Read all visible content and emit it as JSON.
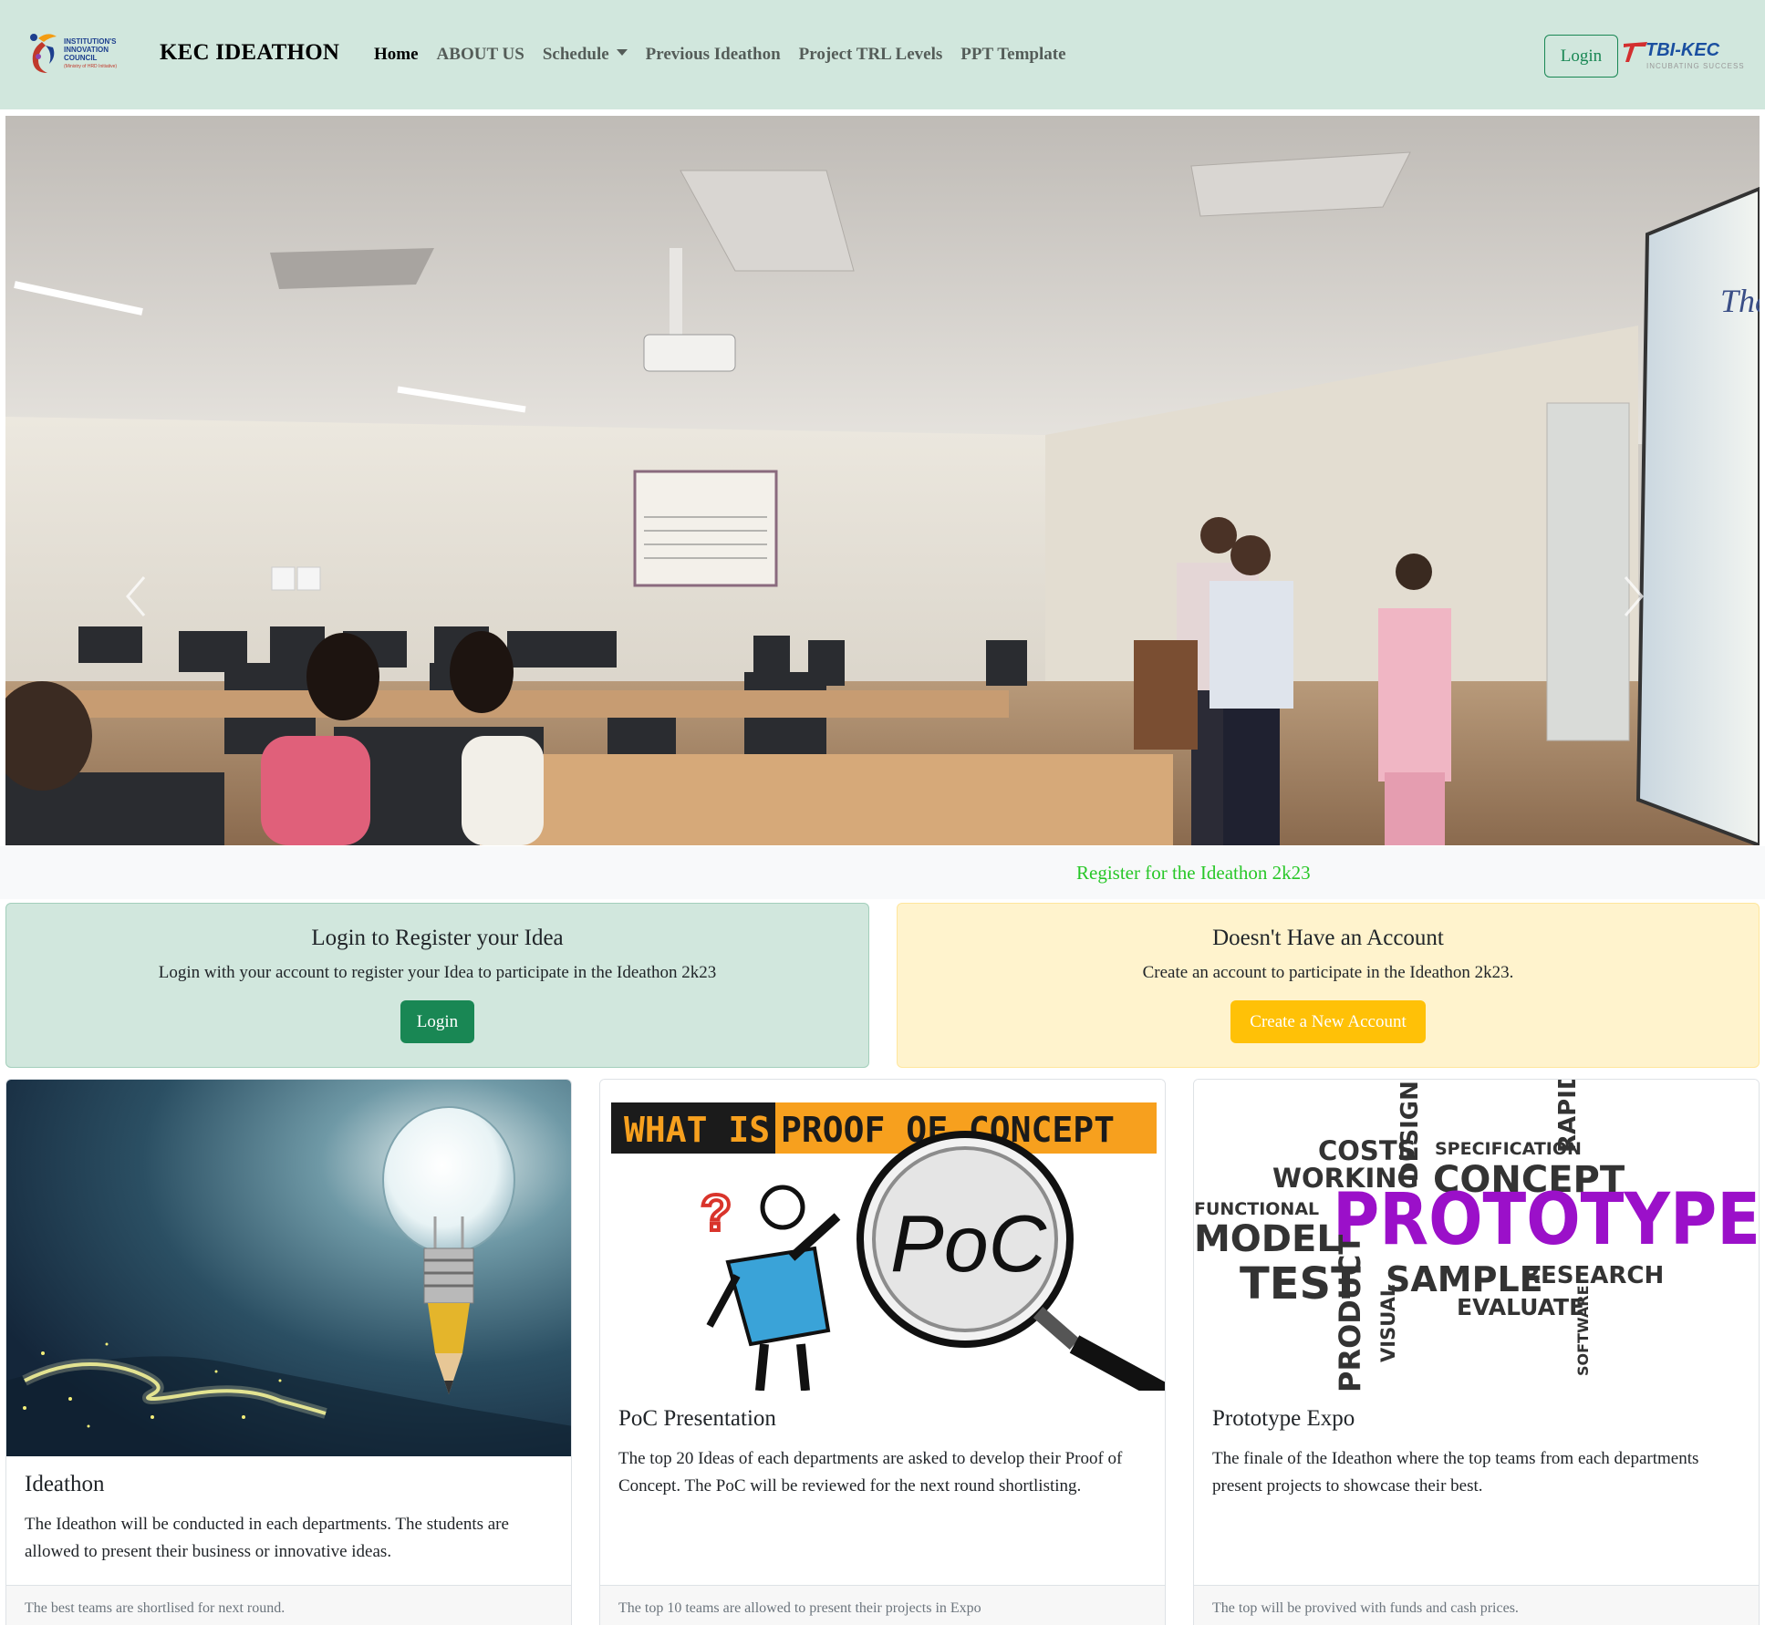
{
  "navbar": {
    "iic_logo_text": "INSTITUTION'S INNOVATION COUNCIL",
    "iic_logo_subtext": "(Ministry of HRD Initiative)",
    "brand": "KEC IDEATHON",
    "links": [
      {
        "label": "Home",
        "active": true
      },
      {
        "label": "ABOUT US"
      },
      {
        "label": "Schedule",
        "dropdown": true
      },
      {
        "label": "Previous Ideathon"
      },
      {
        "label": "Project TRL Levels"
      },
      {
        "label": "PPT Template"
      }
    ],
    "login_label": "Login",
    "tbi_logo_text": "TBI-KEC",
    "tbi_logo_subtext": "INCUBATING SUCCESS"
  },
  "carousel": {
    "prev_icon": "chevron-left-icon",
    "next_icon": "chevron-right-icon",
    "screen_text": "The P"
  },
  "marquee": {
    "text": "Register for the Ideathon 2k23",
    "color": "#28c728"
  },
  "login_callout": {
    "title": "Login to Register your Idea",
    "text": "Login with your account to register your Idea to participate in the Ideathon 2k23",
    "button": "Login"
  },
  "account_callout": {
    "title": "Doesn't Have an Account",
    "text": "Create an account to participate in the Ideathon 2k23.",
    "button": "Create a New Account"
  },
  "cards": [
    {
      "title": "Ideathon",
      "text": "The Ideathon will be conducted in each departments. The students are allowed to present their business or innovative ideas.",
      "footer": "The best teams are shortlised for next round."
    },
    {
      "title": "PoC Presentation",
      "text": "The top 20 Ideas of each departments are asked to develop their Proof of Concept. The PoC will be reviewed for the next round shortlisting.",
      "footer": "The top 10 teams are allowed to present their projects in Expo",
      "image_heading_1": "WHAT IS",
      "image_heading_2": "PROOF OF CONCEPT",
      "image_label": "PoC"
    },
    {
      "title": "Prototype Expo",
      "text": "The finale of the Ideathon where the top teams from each departments present projects to showcase their best.",
      "footer": "The top will be provived with funds and cash prices.",
      "wordcloud": {
        "costs": "COSTS",
        "design": "DESIGN",
        "specification": "SPECIFICATION",
        "rapid": "RAPID",
        "working": "WORKING",
        "concept": "CONCEPT",
        "functional": "FUNCTIONAL",
        "model": "MODEL",
        "prototype": "PROTOTYPE",
        "test": "TEST",
        "sample": "SAMPLE",
        "research": "RESEARCH",
        "evaluate": "EVALUATE",
        "product": "PRODUCT",
        "visual": "VISUAL",
        "software": "SOFTWARE"
      }
    }
  ],
  "colors": {
    "navbar_bg": "#d1e7dd",
    "success": "#198754",
    "warning": "#ffc107",
    "prototype_purple": "#9b10c9"
  }
}
